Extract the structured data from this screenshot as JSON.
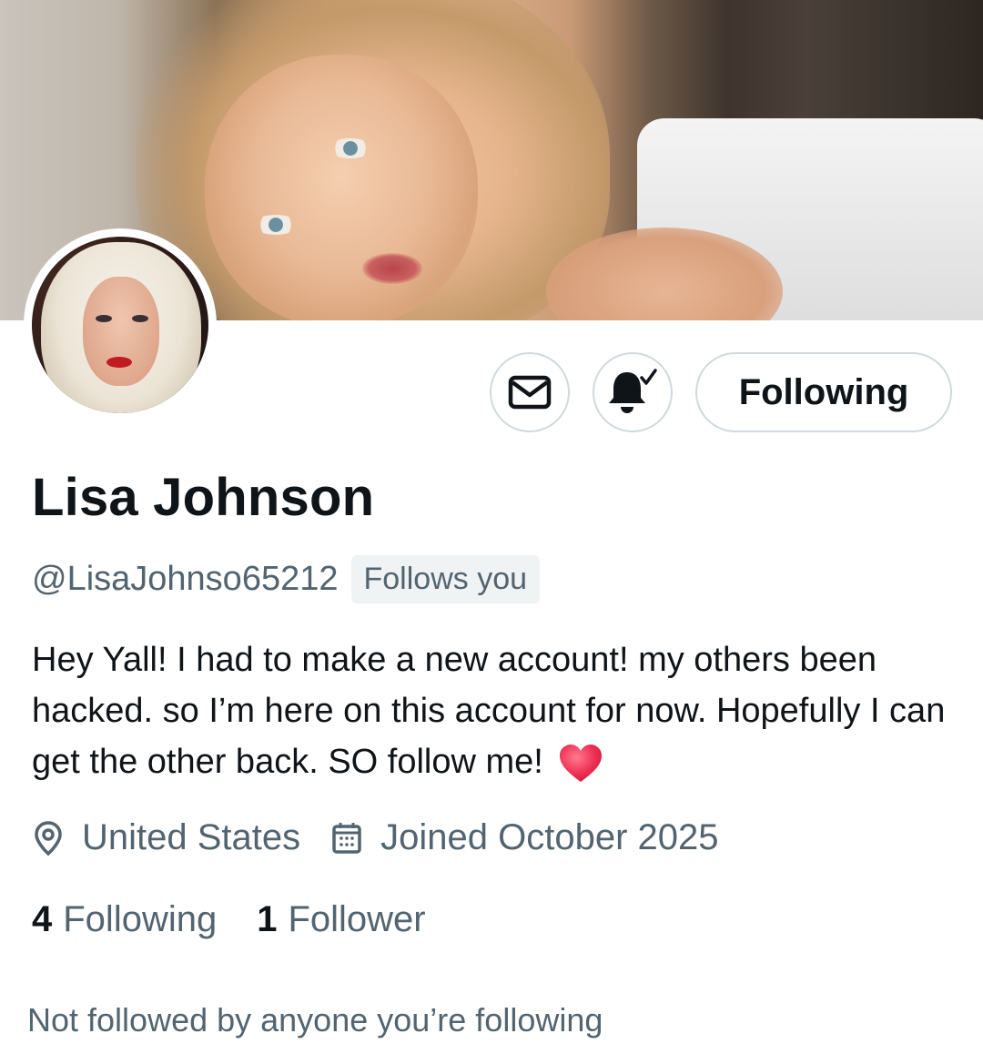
{
  "profile": {
    "name": "Lisa Johnson",
    "handle": "@LisaJohnso65212",
    "follows_you_badge": "Follows you",
    "bio_text": "Hey Yall! I had to make a new account! my others been hacked. so I’m here on this account for now. Hopefully I can get the other back. SO follow me!",
    "bio_emoji": "heart-emoji",
    "location": "United States",
    "joined": "Joined October 2025",
    "following_count": "4",
    "following_label": "Following",
    "followers_count": "1",
    "followers_label": "Follower",
    "mutuals_note": "Not followed by anyone you’re following"
  },
  "actions": {
    "message_icon": "envelope-icon",
    "notifications_icon": "bell-check-icon",
    "follow_button_label": "Following"
  },
  "colors": {
    "text_primary": "#0f1419",
    "text_secondary": "#536471",
    "border": "#cfd9de",
    "badge_bg": "#eff3f4",
    "heart": "#e8203e"
  }
}
